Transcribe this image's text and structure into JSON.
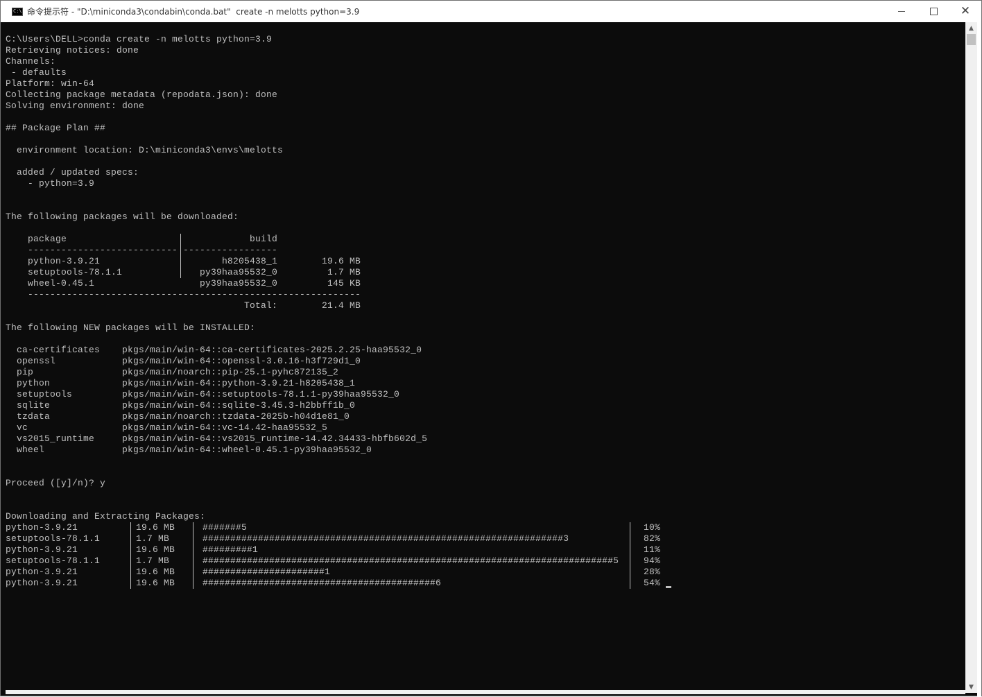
{
  "window": {
    "title": "命令提示符 - \"D:\\miniconda3\\condabin\\conda.bat\"  create -n melotts python=3.9",
    "icon_text": "C:\\"
  },
  "console": {
    "lines": [
      "C:\\Users\\DELL>conda create -n melotts python=3.9",
      "Retrieving notices: done",
      "Channels:",
      " - defaults",
      "Platform: win-64",
      "Collecting package metadata (repodata.json): done",
      "Solving environment: done",
      "",
      "## Package Plan ##",
      "",
      "  environment location: D:\\miniconda3\\envs\\melotts",
      "",
      "  added / updated specs:",
      "    - python=3.9",
      "",
      "",
      "The following packages will be downloaded:"
    ],
    "download_table": {
      "header_package": "package",
      "header_build": "build",
      "sep_left": "---------------------------",
      "sep_right": "-----------------",
      "rows": [
        {
          "package": "python-3.9.21",
          "build": "h8205438_1",
          "size": "19.6 MB"
        },
        {
          "package": "setuptools-78.1.1",
          "build": "py39haa95532_0",
          "size": "1.7 MB"
        },
        {
          "package": "wheel-0.45.1",
          "build": "py39haa95532_0",
          "size": "145 KB"
        }
      ],
      "bottom_sep": "------------------------------------------------------------",
      "total_label": "Total:",
      "total_value": "21.4 MB"
    },
    "new_packages_heading": "The following NEW packages will be INSTALLED:",
    "new_packages": [
      {
        "name": "ca-certificates",
        "spec": "pkgs/main/win-64::ca-certificates-2025.2.25-haa95532_0"
      },
      {
        "name": "openssl",
        "spec": "pkgs/main/win-64::openssl-3.0.16-h3f729d1_0"
      },
      {
        "name": "pip",
        "spec": "pkgs/main/noarch::pip-25.1-pyhc872135_2"
      },
      {
        "name": "python",
        "spec": "pkgs/main/win-64::python-3.9.21-h8205438_1"
      },
      {
        "name": "setuptools",
        "spec": "pkgs/main/win-64::setuptools-78.1.1-py39haa95532_0"
      },
      {
        "name": "sqlite",
        "spec": "pkgs/main/win-64::sqlite-3.45.3-h2bbff1b_0"
      },
      {
        "name": "tzdata",
        "spec": "pkgs/main/noarch::tzdata-2025b-h04d1e81_0"
      },
      {
        "name": "vc",
        "spec": "pkgs/main/win-64::vc-14.42-haa95532_5"
      },
      {
        "name": "vs2015_runtime",
        "spec": "pkgs/main/win-64::vs2015_runtime-14.42.34433-hbfb602d_5"
      },
      {
        "name": "wheel",
        "spec": "pkgs/main/win-64::wheel-0.45.1-py39haa95532_0"
      }
    ],
    "proceed": "Proceed ([y]/n)? y",
    "downloading_heading": "Downloading and Extracting Packages:",
    "progress_rows": [
      {
        "package": "python-3.9.21",
        "size": "19.6 MB",
        "bar": "#######5",
        "percent": "10%"
      },
      {
        "package": "setuptools-78.1.1",
        "size": "1.7 MB",
        "bar": "#################################################################3",
        "percent": "82%"
      },
      {
        "package": "python-3.9.21",
        "size": "19.6 MB",
        "bar": "#########1",
        "percent": "11%"
      },
      {
        "package": "setuptools-78.1.1",
        "size": "1.7 MB",
        "bar": "##########################################################################5",
        "percent": "94%"
      },
      {
        "package": "python-3.9.21",
        "size": "19.6 MB",
        "bar": "######################1",
        "percent": "28%"
      },
      {
        "package": "python-3.9.21",
        "size": "19.6 MB",
        "bar": "##########################################6",
        "percent": "54%"
      }
    ]
  }
}
